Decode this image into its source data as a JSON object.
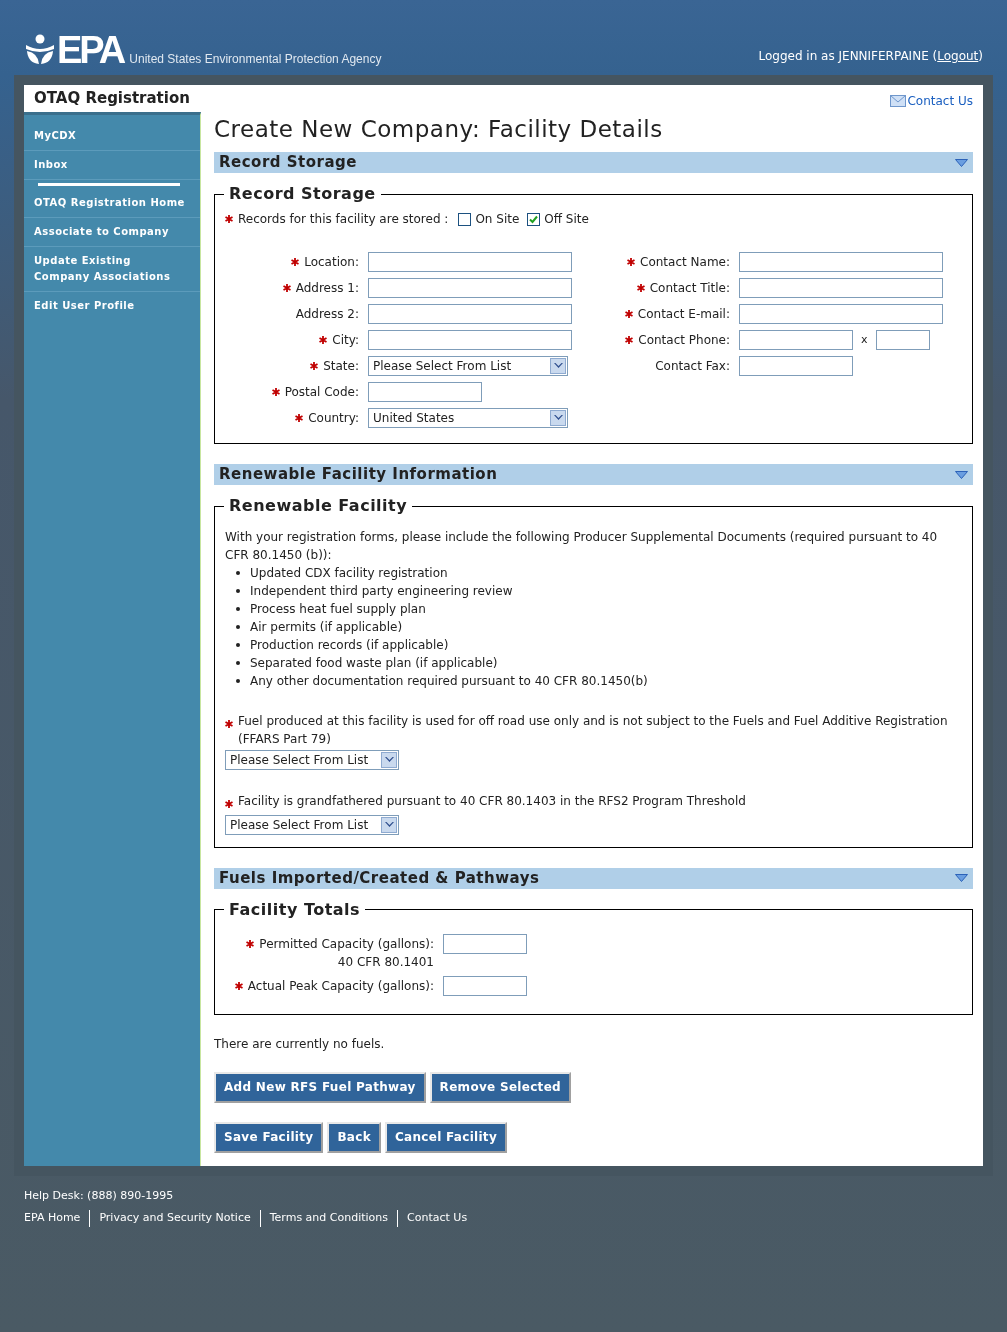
{
  "header": {
    "logo": "EPA",
    "agency": "United States Environmental Protection Agency",
    "login_prefix": "Logged in as JENNIFERPAINE (",
    "logout": "Logout",
    "login_suffix": ")"
  },
  "app_title": "OTAQ Registration",
  "contact_link": "Contact Us",
  "sidebar": {
    "groups": [
      [
        "MyCDX",
        "Inbox"
      ],
      [
        "OTAQ Registration Home",
        "Associate to Company",
        "Update Existing Company Associations",
        "Edit User Profile"
      ]
    ]
  },
  "page_title": "Create New Company: Facility Details",
  "record_storage": {
    "header": "Record Storage",
    "legend": "Record Storage",
    "question": {
      "label": "Records for this facility are stored :",
      "required": true,
      "options": [
        {
          "label": "On Site",
          "checked": false
        },
        {
          "label": "Off Site",
          "checked": true
        }
      ]
    },
    "left_fields": [
      {
        "label": "Location:",
        "required": true,
        "kind": "text"
      },
      {
        "label": "Address 1:",
        "required": true,
        "kind": "text"
      },
      {
        "label": "Address 2:",
        "required": false,
        "kind": "text"
      },
      {
        "label": "City:",
        "required": true,
        "kind": "text"
      },
      {
        "label": "State:",
        "required": true,
        "kind": "select",
        "value": "Please Select From List"
      },
      {
        "label": "Postal Code:",
        "required": true,
        "kind": "short"
      },
      {
        "label": "Country:",
        "required": true,
        "kind": "select",
        "value": "United States"
      }
    ],
    "right_fields": [
      {
        "label": "Contact Name:",
        "required": true,
        "kind": "text"
      },
      {
        "label": "Contact Title:",
        "required": true,
        "kind": "text"
      },
      {
        "label": "Contact E-mail:",
        "required": true,
        "kind": "text"
      },
      {
        "label": "Contact Phone:",
        "required": true,
        "kind": "phone",
        "extension_label": "x"
      },
      {
        "label": "Contact Fax:",
        "required": false,
        "kind": "short"
      }
    ]
  },
  "renewable": {
    "header": "Renewable Facility Information",
    "legend": "Renewable Facility",
    "intro": "With your registration forms, please include the following Producer Supplemental Documents (required pursuant to 40 CFR 80.1450 (b)):",
    "documents": [
      "Updated CDX facility registration",
      "Independent third party engineering review",
      "Process heat fuel supply plan",
      "Air permits (if applicable)",
      "Production records (if applicable)",
      "Separated food waste plan (if applicable)",
      "Any other documentation required pursuant to 40 CFR 80.1450(b)"
    ],
    "questions": [
      {
        "label": "Fuel produced at this facility is used for off road use only and is not subject to the Fuels and Fuel Additive Registration (FFARS Part 79)",
        "required": true,
        "value": "Please Select From List"
      },
      {
        "label": "Facility is grandfathered pursuant to 40 CFR 80.1403 in the RFS2 Program Threshold",
        "required": true,
        "value": "Please Select From List"
      }
    ]
  },
  "fuels": {
    "header": "Fuels Imported/Created & Pathways",
    "legend": "Facility Totals",
    "fields": [
      {
        "label": "Permitted Capacity (gallons):",
        "required": true,
        "note": "40 CFR 80.1401"
      },
      {
        "label": "Actual Peak Capacity (gallons):",
        "required": true
      }
    ],
    "empty_message": "There are currently no fuels."
  },
  "button_rows": [
    [
      "Add New RFS Fuel Pathway",
      "Remove Selected"
    ],
    [
      "Save Facility",
      "Back",
      "Cancel Facility"
    ]
  ],
  "footer": {
    "help_desk": "Help Desk: (888) 890-1995",
    "links": [
      "EPA Home",
      "Privacy and Security Notice",
      "Terms and Conditions",
      "Contact Us"
    ]
  }
}
